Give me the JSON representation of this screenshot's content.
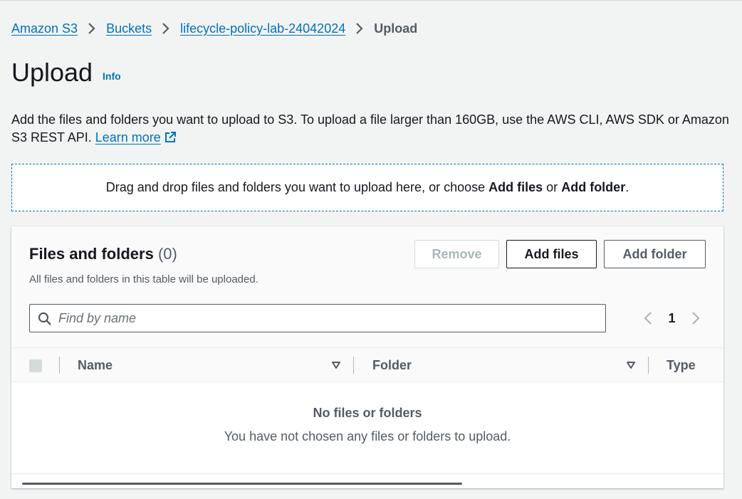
{
  "breadcrumb": {
    "items": [
      "Amazon S3",
      "Buckets",
      "lifecycle-policy-lab-24042024"
    ],
    "current": "Upload"
  },
  "page": {
    "title": "Upload",
    "info": "Info"
  },
  "description": {
    "text": "Add the files and folders you want to upload to S3. To upload a file larger than 160GB, use the AWS CLI, AWS SDK or Amazon S3 REST API.",
    "link": "Learn more"
  },
  "dropzone": {
    "prefix": "Drag and drop files and folders you want to upload here, or choose",
    "add_files": "Add files",
    "or": "or",
    "add_folder": "Add folder",
    "suffix": "."
  },
  "files_panel": {
    "title": "Files and folders",
    "count": "(0)",
    "subtitle": "All files and folders in this table will be uploaded.",
    "buttons": {
      "remove": "Remove",
      "add_files": "Add files",
      "add_folder": "Add folder"
    },
    "search": {
      "placeholder": "Find by name",
      "value": ""
    },
    "pagination": {
      "current_page": "1"
    },
    "columns": [
      "Name",
      "Folder",
      "Type"
    ],
    "empty": {
      "title": "No files or folders",
      "message": "You have not chosen any files or folders to upload."
    }
  },
  "icons": {
    "breadcrumb_separator": "chevron-right-icon",
    "external_link": "external-link-icon",
    "search": "search-icon",
    "prev_page": "chevron-left-icon",
    "next_page": "chevron-right-icon",
    "sort": "sort-down-icon"
  },
  "colors": {
    "link": "#0073bb",
    "background": "#f2f3f3",
    "text": "#16191f",
    "secondary_text": "#545b64",
    "disabled": "#aab7b8"
  }
}
